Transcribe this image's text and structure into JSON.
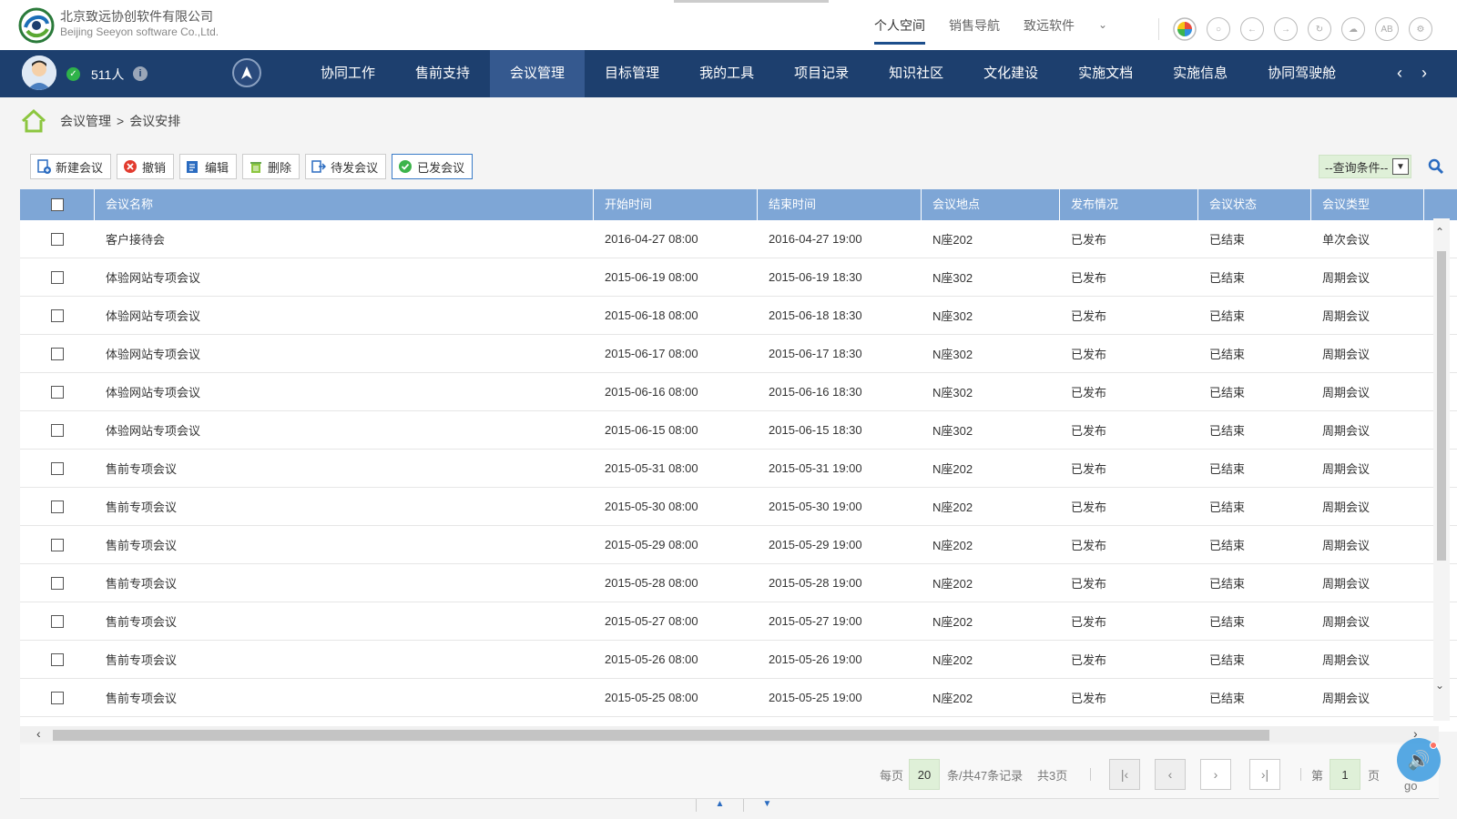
{
  "header": {
    "company_cn": "北京致远协创软件有限公司",
    "company_en": "Beijing Seeyon software Co.,Ltd.",
    "top_nav": [
      {
        "label": "个人空间",
        "active": true
      },
      {
        "label": "销售导航",
        "active": false
      },
      {
        "label": "致远软件",
        "active": false
      }
    ],
    "tool_icons": [
      "color-wheel-icon",
      "search-circle-icon",
      "back-icon",
      "forward-icon",
      "refresh-icon",
      "cloud-icon",
      "ab-icon",
      "settings-icon"
    ],
    "ab_text": "AB"
  },
  "navbar": {
    "online_count": "511人",
    "menu": [
      {
        "label": "协同工作",
        "active": false
      },
      {
        "label": "售前支持",
        "active": false
      },
      {
        "label": "会议管理",
        "active": true
      },
      {
        "label": "目标管理",
        "active": false
      },
      {
        "label": "我的工具",
        "active": false
      },
      {
        "label": "项目记录",
        "active": false
      },
      {
        "label": "知识社区",
        "active": false
      },
      {
        "label": "文化建设",
        "active": false
      },
      {
        "label": "实施文档",
        "active": false
      },
      {
        "label": "实施信息",
        "active": false
      },
      {
        "label": "协同驾驶舱",
        "active": false
      }
    ],
    "colors": {
      "bar": "#1d3f6e",
      "active": "#35598f"
    }
  },
  "breadcrumb": {
    "items": [
      "会议管理",
      "会议安排"
    ],
    "separator": ">"
  },
  "toolbar": {
    "buttons": [
      {
        "label": "新建会议",
        "icon": "new-meeting-icon"
      },
      {
        "label": "撤销",
        "icon": "cancel-icon"
      },
      {
        "label": "编辑",
        "icon": "edit-icon"
      },
      {
        "label": "删除",
        "icon": "trash-icon"
      },
      {
        "label": "待发会议",
        "icon": "pending-send-icon"
      },
      {
        "label": "已发会议",
        "icon": "sent-check-icon"
      }
    ],
    "query_placeholder": "--查询条件--"
  },
  "table": {
    "columns": [
      "会议名称",
      "开始时间",
      "结束时间",
      "会议地点",
      "发布情况",
      "会议状态",
      "会议类型"
    ],
    "rows": [
      [
        "客户接待会",
        "2016-04-27 08:00",
        "2016-04-27 19:00",
        "N座202",
        "已发布",
        "已结束",
        "单次会议"
      ],
      [
        "体验网站专项会议",
        "2015-06-19 08:00",
        "2015-06-19 18:30",
        "N座302",
        "已发布",
        "已结束",
        "周期会议"
      ],
      [
        "体验网站专项会议",
        "2015-06-18 08:00",
        "2015-06-18 18:30",
        "N座302",
        "已发布",
        "已结束",
        "周期会议"
      ],
      [
        "体验网站专项会议",
        "2015-06-17 08:00",
        "2015-06-17 18:30",
        "N座302",
        "已发布",
        "已结束",
        "周期会议"
      ],
      [
        "体验网站专项会议",
        "2015-06-16 08:00",
        "2015-06-16 18:30",
        "N座302",
        "已发布",
        "已结束",
        "周期会议"
      ],
      [
        "体验网站专项会议",
        "2015-06-15 08:00",
        "2015-06-15 18:30",
        "N座302",
        "已发布",
        "已结束",
        "周期会议"
      ],
      [
        "售前专项会议",
        "2015-05-31 08:00",
        "2015-05-31 19:00",
        "N座202",
        "已发布",
        "已结束",
        "周期会议"
      ],
      [
        "售前专项会议",
        "2015-05-30 08:00",
        "2015-05-30 19:00",
        "N座202",
        "已发布",
        "已结束",
        "周期会议"
      ],
      [
        "售前专项会议",
        "2015-05-29 08:00",
        "2015-05-29 19:00",
        "N座202",
        "已发布",
        "已结束",
        "周期会议"
      ],
      [
        "售前专项会议",
        "2015-05-28 08:00",
        "2015-05-28 19:00",
        "N座202",
        "已发布",
        "已结束",
        "周期会议"
      ],
      [
        "售前专项会议",
        "2015-05-27 08:00",
        "2015-05-27 19:00",
        "N座202",
        "已发布",
        "已结束",
        "周期会议"
      ],
      [
        "售前专项会议",
        "2015-05-26 08:00",
        "2015-05-26 19:00",
        "N座202",
        "已发布",
        "已结束",
        "周期会议"
      ],
      [
        "售前专项会议",
        "2015-05-25 08:00",
        "2015-05-25 19:00",
        "N座202",
        "已发布",
        "已结束",
        "周期会议"
      ]
    ]
  },
  "pager": {
    "per_page_label": "每页",
    "per_page_value": "20",
    "records_label": "条/共47条记录",
    "pages_label": "共3页",
    "page_prefix": "第",
    "page_value": "1",
    "page_suffix": "页",
    "go_label": "go"
  },
  "colors": {
    "header_row": "#7ea6d6",
    "accent_green": "#dff0d8"
  }
}
